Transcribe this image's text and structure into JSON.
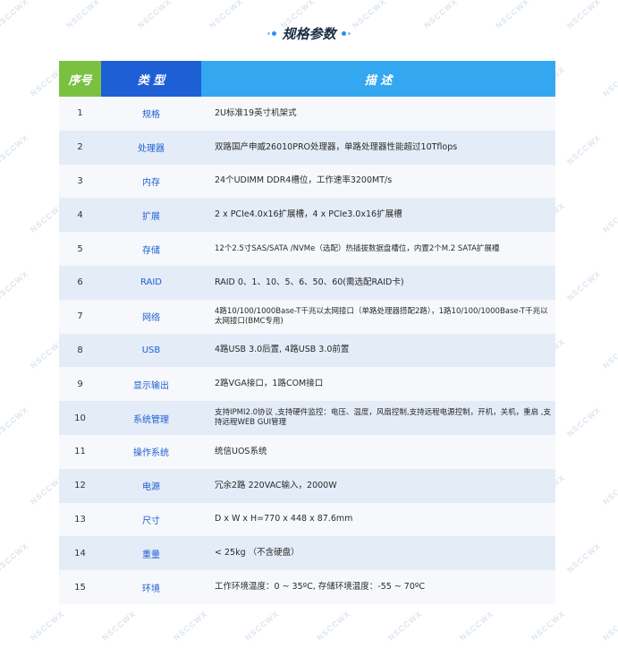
{
  "title": "规格参数",
  "watermark": "NSCCWX",
  "table": {
    "headers": {
      "no": "序号",
      "type": "类  型",
      "desc": "描  述"
    },
    "rows": [
      {
        "no": "1",
        "type": "规格",
        "desc": "2U标准19英寸机架式"
      },
      {
        "no": "2",
        "type": "处理器",
        "desc": "双路国产申威26010PRO处理器，单路处理器性能超过10Tflops"
      },
      {
        "no": "3",
        "type": "内存",
        "desc": "24个UDIMM DDR4槽位，工作速率3200MT/s"
      },
      {
        "no": "4",
        "type": "扩展",
        "desc": "2 x PCIe4.0x16扩展槽，4 x PCIe3.0x16扩展槽"
      },
      {
        "no": "5",
        "type": "存储",
        "desc": "12个2.5寸SAS/SATA /NVMe（选配）热插拔数据盘槽位，内置2个M.2 SATA扩展槽"
      },
      {
        "no": "6",
        "type": "RAID",
        "desc": "RAID 0、1、10、5、6、50、60(需选配RAID卡)"
      },
      {
        "no": "7",
        "type": "网络",
        "desc": "4路10/100/1000Base-T千兆以太网接口（单路处理器搭配2路），1路10/100/1000Base-T千兆以太网接口(BMC专用)"
      },
      {
        "no": "8",
        "type": "USB",
        "desc": "4路USB 3.0后置, 4路USB 3.0前置"
      },
      {
        "no": "9",
        "type": "显示输出",
        "desc": "2路VGA接口，1路COM接口"
      },
      {
        "no": "10",
        "type": "系统管理",
        "desc": "支持IPMI2.0协议 ,支持硬件监控：电压、温度，风扇控制,支持远程电源控制，开机，关机，重启 ,支持远程WEB GUI管理"
      },
      {
        "no": "11",
        "type": "操作系统",
        "desc": "统信UOS系统"
      },
      {
        "no": "12",
        "type": "电源",
        "desc": "冗余2路 220VAC输入，2000W"
      },
      {
        "no": "13",
        "type": "尺寸",
        "desc": "D x W x H=770 x 448 x 87.6mm"
      },
      {
        "no": "14",
        "type": "重量",
        "desc": "< 25kg （不含硬盘）"
      },
      {
        "no": "15",
        "type": "环境",
        "desc": "工作环境温度：0 ~ 35ºC, 存储环境温度：-55 ~ 70ºC"
      }
    ]
  }
}
